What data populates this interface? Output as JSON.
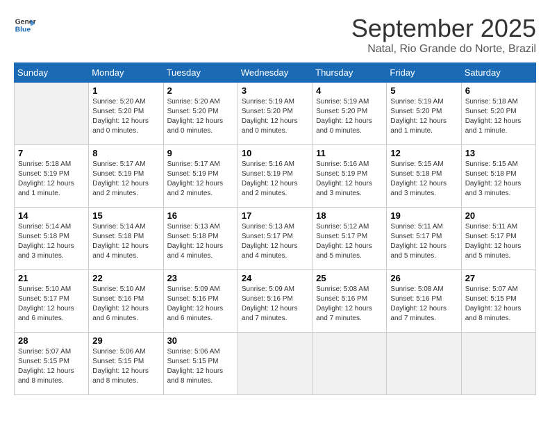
{
  "header": {
    "logo_line1": "General",
    "logo_line2": "Blue",
    "title": "September 2025",
    "subtitle": "Natal, Rio Grande do Norte, Brazil"
  },
  "columns": [
    "Sunday",
    "Monday",
    "Tuesday",
    "Wednesday",
    "Thursday",
    "Friday",
    "Saturday"
  ],
  "weeks": [
    [
      {
        "day": "",
        "info": ""
      },
      {
        "day": "1",
        "info": "Sunrise: 5:20 AM\nSunset: 5:20 PM\nDaylight: 12 hours\nand 0 minutes."
      },
      {
        "day": "2",
        "info": "Sunrise: 5:20 AM\nSunset: 5:20 PM\nDaylight: 12 hours\nand 0 minutes."
      },
      {
        "day": "3",
        "info": "Sunrise: 5:19 AM\nSunset: 5:20 PM\nDaylight: 12 hours\nand 0 minutes."
      },
      {
        "day": "4",
        "info": "Sunrise: 5:19 AM\nSunset: 5:20 PM\nDaylight: 12 hours\nand 0 minutes."
      },
      {
        "day": "5",
        "info": "Sunrise: 5:19 AM\nSunset: 5:20 PM\nDaylight: 12 hours\nand 1 minute."
      },
      {
        "day": "6",
        "info": "Sunrise: 5:18 AM\nSunset: 5:20 PM\nDaylight: 12 hours\nand 1 minute."
      }
    ],
    [
      {
        "day": "7",
        "info": "Sunrise: 5:18 AM\nSunset: 5:19 PM\nDaylight: 12 hours\nand 1 minute."
      },
      {
        "day": "8",
        "info": "Sunrise: 5:17 AM\nSunset: 5:19 PM\nDaylight: 12 hours\nand 2 minutes."
      },
      {
        "day": "9",
        "info": "Sunrise: 5:17 AM\nSunset: 5:19 PM\nDaylight: 12 hours\nand 2 minutes."
      },
      {
        "day": "10",
        "info": "Sunrise: 5:16 AM\nSunset: 5:19 PM\nDaylight: 12 hours\nand 2 minutes."
      },
      {
        "day": "11",
        "info": "Sunrise: 5:16 AM\nSunset: 5:19 PM\nDaylight: 12 hours\nand 3 minutes."
      },
      {
        "day": "12",
        "info": "Sunrise: 5:15 AM\nSunset: 5:18 PM\nDaylight: 12 hours\nand 3 minutes."
      },
      {
        "day": "13",
        "info": "Sunrise: 5:15 AM\nSunset: 5:18 PM\nDaylight: 12 hours\nand 3 minutes."
      }
    ],
    [
      {
        "day": "14",
        "info": "Sunrise: 5:14 AM\nSunset: 5:18 PM\nDaylight: 12 hours\nand 3 minutes."
      },
      {
        "day": "15",
        "info": "Sunrise: 5:14 AM\nSunset: 5:18 PM\nDaylight: 12 hours\nand 4 minutes."
      },
      {
        "day": "16",
        "info": "Sunrise: 5:13 AM\nSunset: 5:18 PM\nDaylight: 12 hours\nand 4 minutes."
      },
      {
        "day": "17",
        "info": "Sunrise: 5:13 AM\nSunset: 5:17 PM\nDaylight: 12 hours\nand 4 minutes."
      },
      {
        "day": "18",
        "info": "Sunrise: 5:12 AM\nSunset: 5:17 PM\nDaylight: 12 hours\nand 5 minutes."
      },
      {
        "day": "19",
        "info": "Sunrise: 5:11 AM\nSunset: 5:17 PM\nDaylight: 12 hours\nand 5 minutes."
      },
      {
        "day": "20",
        "info": "Sunrise: 5:11 AM\nSunset: 5:17 PM\nDaylight: 12 hours\nand 5 minutes."
      }
    ],
    [
      {
        "day": "21",
        "info": "Sunrise: 5:10 AM\nSunset: 5:17 PM\nDaylight: 12 hours\nand 6 minutes."
      },
      {
        "day": "22",
        "info": "Sunrise: 5:10 AM\nSunset: 5:16 PM\nDaylight: 12 hours\nand 6 minutes."
      },
      {
        "day": "23",
        "info": "Sunrise: 5:09 AM\nSunset: 5:16 PM\nDaylight: 12 hours\nand 6 minutes."
      },
      {
        "day": "24",
        "info": "Sunrise: 5:09 AM\nSunset: 5:16 PM\nDaylight: 12 hours\nand 7 minutes."
      },
      {
        "day": "25",
        "info": "Sunrise: 5:08 AM\nSunset: 5:16 PM\nDaylight: 12 hours\nand 7 minutes."
      },
      {
        "day": "26",
        "info": "Sunrise: 5:08 AM\nSunset: 5:16 PM\nDaylight: 12 hours\nand 7 minutes."
      },
      {
        "day": "27",
        "info": "Sunrise: 5:07 AM\nSunset: 5:15 PM\nDaylight: 12 hours\nand 8 minutes."
      }
    ],
    [
      {
        "day": "28",
        "info": "Sunrise: 5:07 AM\nSunset: 5:15 PM\nDaylight: 12 hours\nand 8 minutes."
      },
      {
        "day": "29",
        "info": "Sunrise: 5:06 AM\nSunset: 5:15 PM\nDaylight: 12 hours\nand 8 minutes."
      },
      {
        "day": "30",
        "info": "Sunrise: 5:06 AM\nSunset: 5:15 PM\nDaylight: 12 hours\nand 8 minutes."
      },
      {
        "day": "",
        "info": ""
      },
      {
        "day": "",
        "info": ""
      },
      {
        "day": "",
        "info": ""
      },
      {
        "day": "",
        "info": ""
      }
    ]
  ]
}
